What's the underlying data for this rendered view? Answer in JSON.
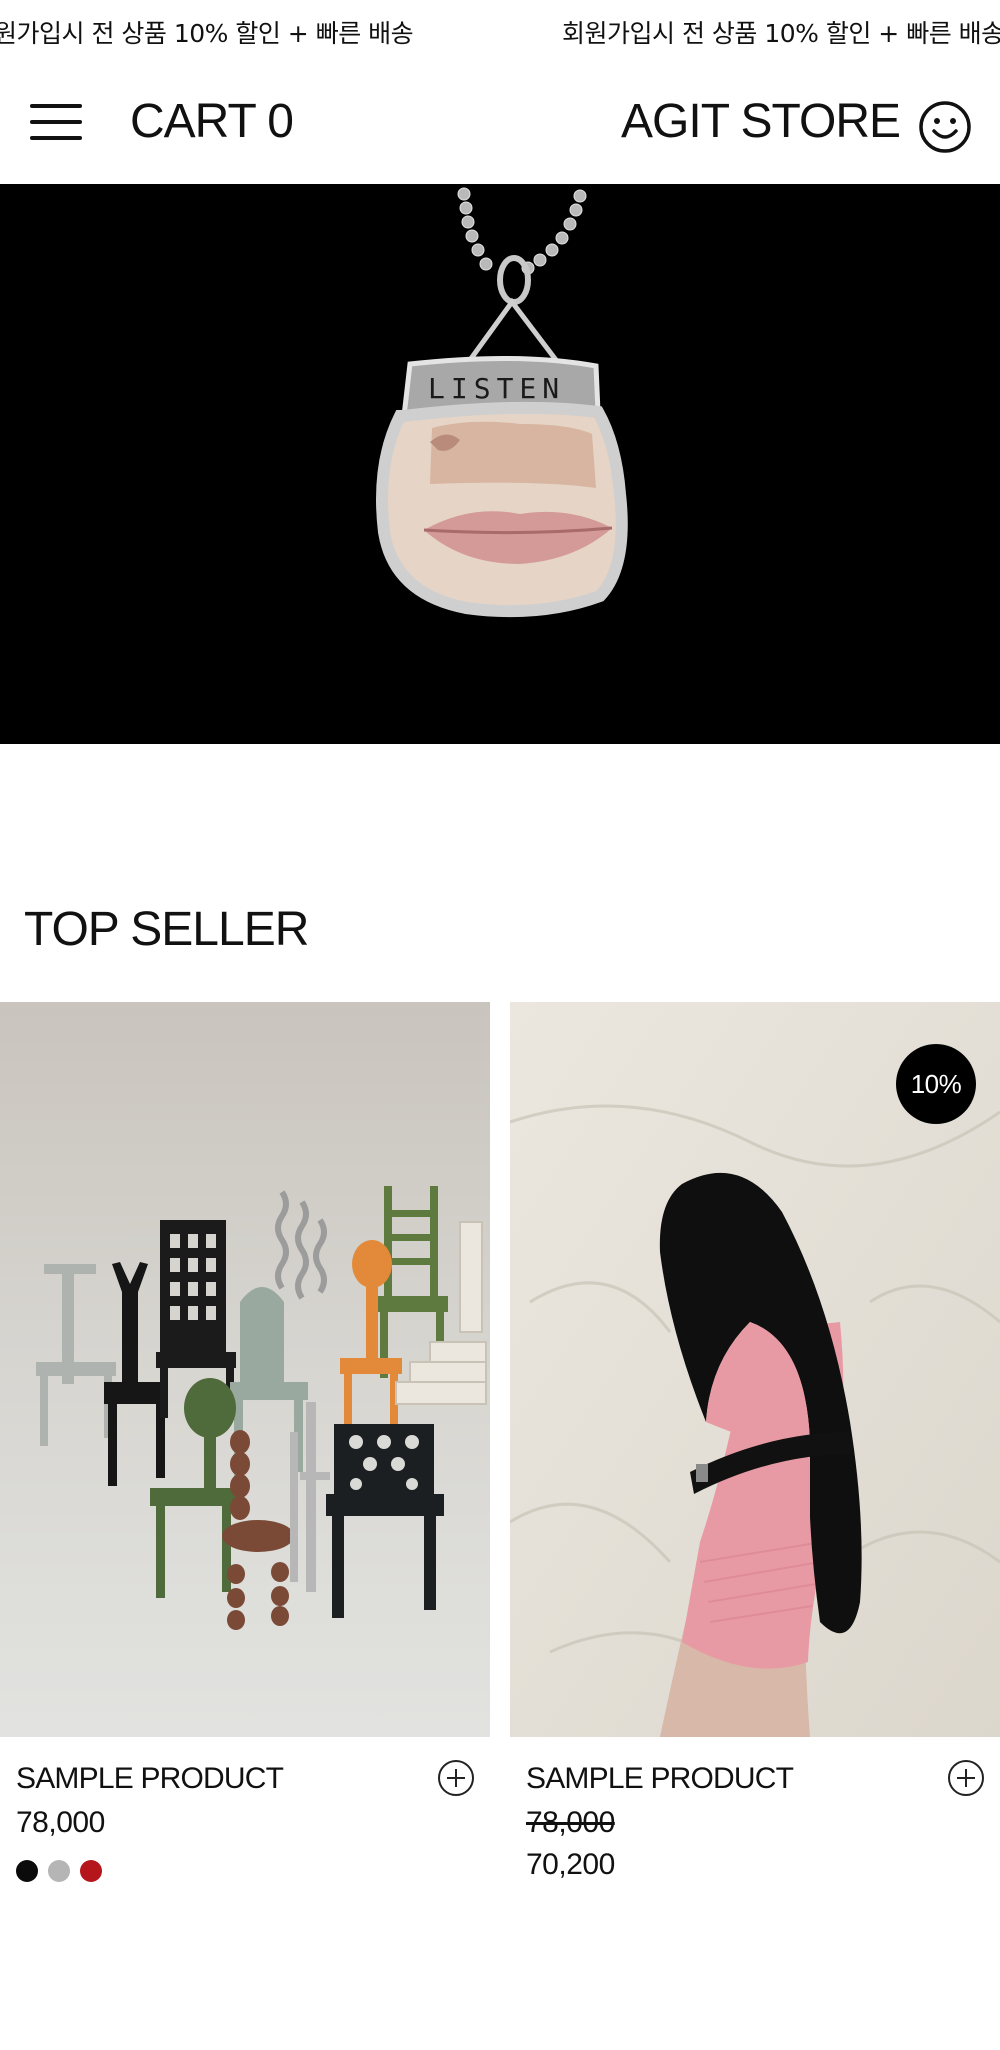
{
  "announcement": {
    "text": "원가입시 전 상품 10% 할인 + 빠른 배송",
    "text_repeat": "회원가입시 전 상품 10% 할인 + 빠른 배송"
  },
  "header": {
    "menu_icon": "hamburger-icon",
    "cart_label": "CART 0",
    "brand": "AGIT STORE",
    "account_icon": "smiley-icon"
  },
  "hero": {
    "image": "pendant-necklace",
    "engraving": "LISTEN"
  },
  "top_seller": {
    "title": "TOP SELLER",
    "products": [
      {
        "name": "SAMPLE PRODUCT",
        "price": "78,000",
        "image": "miniature-chairs",
        "swatches": [
          "#0b0b0b",
          "#b5b5b5",
          "#b5161b"
        ]
      },
      {
        "name": "SAMPLE PRODUCT",
        "original_price": "78,000",
        "sale_price": "70,200",
        "badge": "10%",
        "image": "mary-jane-shoe-pink-sock"
      }
    ]
  }
}
